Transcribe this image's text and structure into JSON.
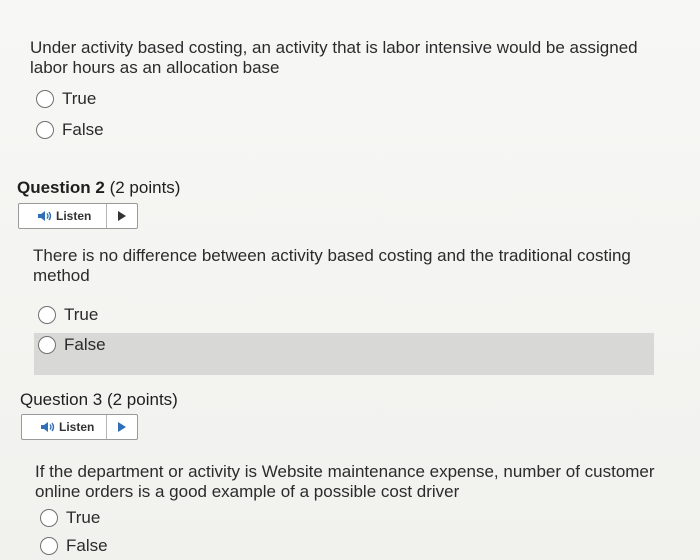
{
  "q1": {
    "text_line1": "Under activity based costing, an activity that is labor intensive would be assigned",
    "text_line2": "labor hours as an allocation base",
    "options": [
      "True",
      "False"
    ]
  },
  "q2": {
    "title": "Question 2",
    "points": "(2 points)",
    "listen_label": "Listen",
    "text_line1": "There is no difference between activity based costing and the traditional costing",
    "text_line2": "method",
    "options": [
      "True",
      "False"
    ]
  },
  "q3": {
    "title": "Question 3",
    "points": "(2 points)",
    "listen_label": "Listen",
    "text_line1": "If the department or activity is Website maintenance expense, number of customer",
    "text_line2": "online orders is a good example of a possible cost driver",
    "options": [
      "True",
      "False"
    ]
  },
  "icons": {
    "speaker": "speaker-icon",
    "play": "play-icon"
  },
  "colors": {
    "text": "#2b2b2b",
    "highlight": "#d8d8d6",
    "speaker_blue": "#2f6fb7"
  }
}
